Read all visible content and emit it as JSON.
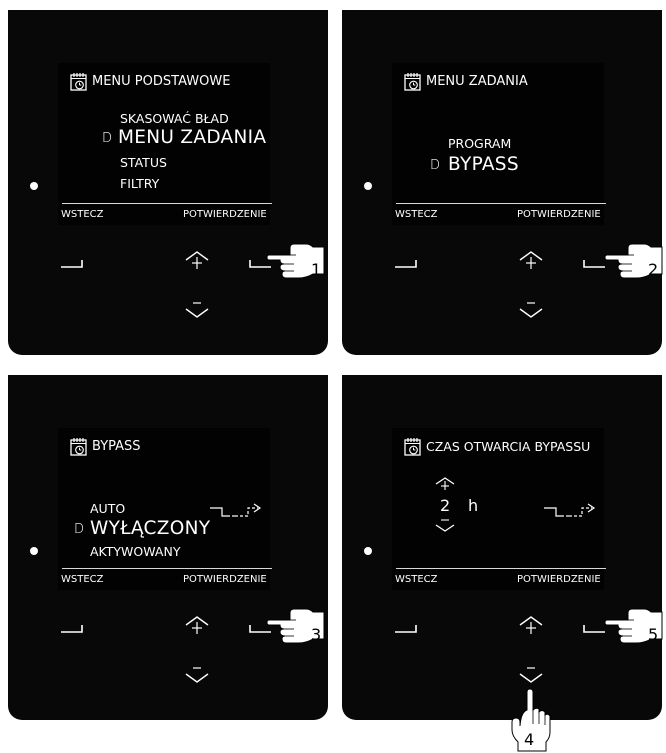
{
  "panels": [
    {
      "title": "MENU PODSTAWOWE",
      "items": [
        "SKASOWAĆ BŁAD",
        "MENU ZADANIA",
        "STATUS",
        "FILTRY"
      ],
      "selected_index": 1,
      "softkey_left": "WSTECZ",
      "softkey_right": "POTWIERDZENIE",
      "step": "1"
    },
    {
      "title": "MENU ZADANIA",
      "items": [
        "PROGRAM",
        "BYPASS"
      ],
      "selected_index": 1,
      "softkey_left": "WSTECZ",
      "softkey_right": "POTWIERDZENIE",
      "step": "2"
    },
    {
      "title": "BYPASS",
      "items": [
        "AUTO",
        "WYŁĄCZONY",
        "AKTYWOWANY"
      ],
      "selected_index": 1,
      "softkey_left": "WSTECZ",
      "softkey_right": "POTWIERDZENIE",
      "step": "3"
    },
    {
      "title": "CZAS OTWARCIA BYPASSU",
      "value_number": "2",
      "value_unit": "h",
      "softkey_left": "WSTECZ",
      "softkey_right": "POTWIERDZENIE",
      "step": "5",
      "step_down": "4"
    }
  ],
  "selector_glyph": "D",
  "icons": {
    "title": "calendar-clock-icon",
    "left": "back-bracket-icon",
    "right": "confirm-bracket-icon",
    "up": "up-plus-icon",
    "down": "down-minus-icon",
    "bypass": "bypass-valve-icon",
    "hand": "pointing-hand-icon"
  }
}
